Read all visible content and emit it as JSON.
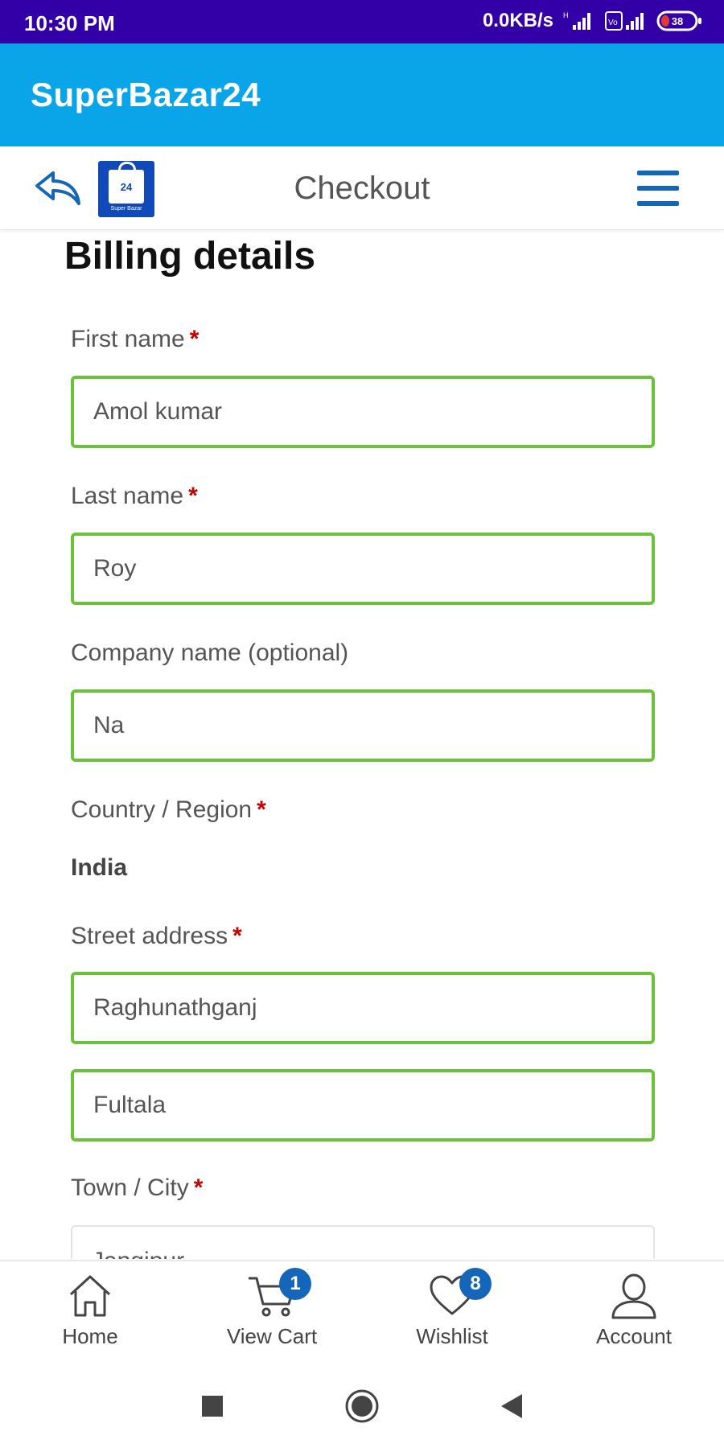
{
  "status_bar": {
    "time": "10:30 PM",
    "network_speed": "0.0KB/s",
    "battery_level": "38",
    "icons": [
      "signal-icon",
      "volte-icon",
      "battery-icon"
    ]
  },
  "app_bar": {
    "title": "SuperBazar24"
  },
  "header": {
    "title": "Checkout",
    "logo_text": "24",
    "logo_caption": "Super Bazar"
  },
  "form": {
    "section_title": "Billing details",
    "required_mark": "*",
    "first_name": {
      "label": "First name",
      "value": "Amol kumar"
    },
    "last_name": {
      "label": "Last name",
      "value": "Roy"
    },
    "company": {
      "label": "Company name (optional)",
      "value": "Na"
    },
    "country": {
      "label": "Country / Region",
      "value": "India"
    },
    "street": {
      "label": "Street address",
      "line1": "Raghunathganj",
      "line2": "Fultala"
    },
    "city": {
      "label": "Town / City",
      "value": "Jangipur"
    }
  },
  "bottom_nav": {
    "items": [
      {
        "label": "Home",
        "icon": "home-icon"
      },
      {
        "label": "View Cart",
        "icon": "cart-icon",
        "badge": "1"
      },
      {
        "label": "Wishlist",
        "icon": "heart-icon",
        "badge": "8"
      },
      {
        "label": "Account",
        "icon": "user-icon"
      }
    ]
  },
  "colors": {
    "status_bar": "#3300a8",
    "app_bar": "#0aa4e8",
    "accent_blue": "#1565b8",
    "valid_border": "#6cc13a",
    "required": "#c40000"
  }
}
